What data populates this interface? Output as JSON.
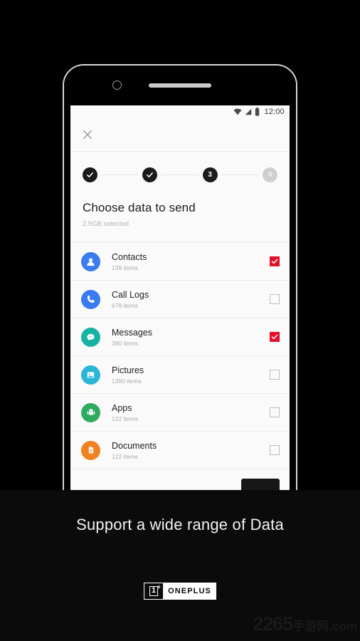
{
  "status_bar": {
    "time": "12:00",
    "icons": [
      "wifi-icon",
      "signal-icon",
      "battery-icon"
    ]
  },
  "app_bar": {
    "close_icon": "close-icon"
  },
  "stepper": {
    "steps": [
      {
        "label": "✓",
        "state": "done"
      },
      {
        "label": "✓",
        "state": "done"
      },
      {
        "label": "3",
        "state": "active"
      },
      {
        "label": "4",
        "state": "inactive"
      }
    ]
  },
  "header": {
    "title": "Choose data to send",
    "subtitle": "2.5GB selected"
  },
  "data_list": [
    {
      "label": "Contacts",
      "count": "139 items",
      "icon": "contacts-icon",
      "color": "#3a7bef",
      "checked": true
    },
    {
      "label": "Call Logs",
      "count": "678 items",
      "icon": "phone-icon",
      "color": "#3a7bef",
      "checked": false
    },
    {
      "label": "Messages",
      "count": "390 items",
      "icon": "message-icon",
      "color": "#16b2a4",
      "checked": true
    },
    {
      "label": "Pictures",
      "count": "1390 items",
      "icon": "picture-icon",
      "color": "#29b6d8",
      "checked": false
    },
    {
      "label": "Apps",
      "count": "122 items",
      "icon": "android-icon",
      "color": "#2eab5e",
      "checked": false
    },
    {
      "label": "Documents",
      "count": "122 items",
      "icon": "document-icon",
      "color": "#f08020",
      "checked": false
    }
  ],
  "send_button": {
    "label": ""
  },
  "promo": {
    "caption": "Support a wide range of Data",
    "brand_mark": "1",
    "brand_plus": "+",
    "brand_word": "ONEPLUS"
  },
  "watermark": {
    "number": "2265",
    "suffix": "手游网.com"
  },
  "colors": {
    "checkbox_checked": "#e4102b",
    "stepper_active": "#1b1b1b",
    "stepper_inactive": "#cfcfcf",
    "background": "#000000",
    "screen": "#fafafa"
  }
}
